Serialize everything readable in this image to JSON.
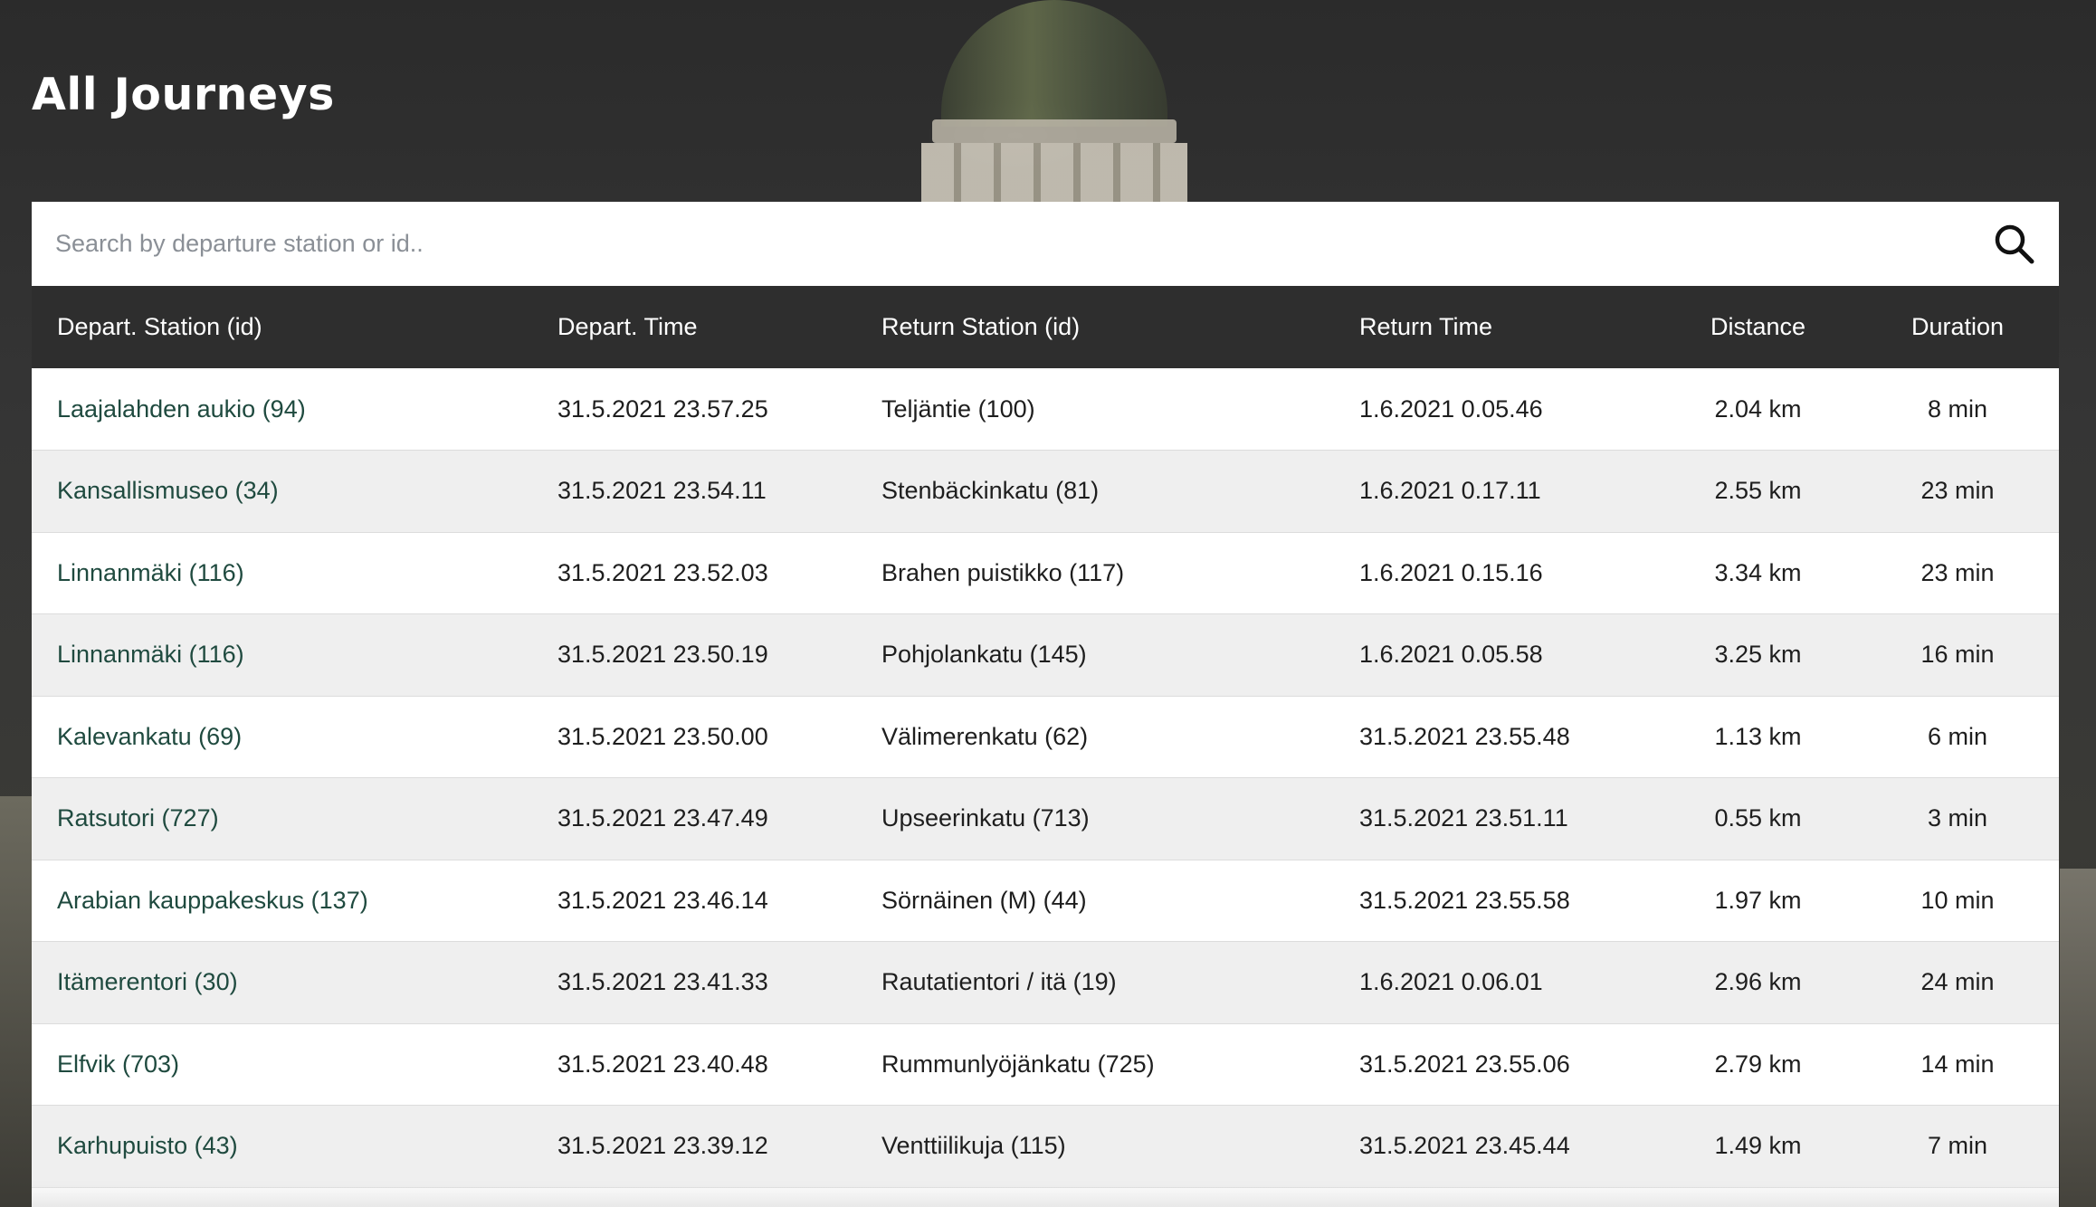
{
  "page": {
    "title": "All Journeys"
  },
  "search": {
    "placeholder": "Search by departure station or id..",
    "icon": "search-icon"
  },
  "table": {
    "headers": {
      "departure_station": "Depart. Station (id)",
      "departure_time": "Depart. Time",
      "return_station": "Return Station (id)",
      "return_time": "Return Time",
      "distance": "Distance",
      "duration": "Duration"
    },
    "rows": [
      {
        "departure_station": "Laajalahden aukio (94)",
        "departure_time": "31.5.2021 23.57.25",
        "return_station": "Teljäntie (100)",
        "return_time": "1.6.2021 0.05.46",
        "distance": "2.04 km",
        "duration": "8 min"
      },
      {
        "departure_station": "Kansallismuseo (34)",
        "departure_time": "31.5.2021 23.54.11",
        "return_station": "Stenbäckinkatu (81)",
        "return_time": "1.6.2021 0.17.11",
        "distance": "2.55 km",
        "duration": "23 min"
      },
      {
        "departure_station": "Linnanmäki (116)",
        "departure_time": "31.5.2021 23.52.03",
        "return_station": "Brahen puistikko (117)",
        "return_time": "1.6.2021 0.15.16",
        "distance": "3.34 km",
        "duration": "23 min"
      },
      {
        "departure_station": "Linnanmäki (116)",
        "departure_time": "31.5.2021 23.50.19",
        "return_station": "Pohjolankatu (145)",
        "return_time": "1.6.2021 0.05.58",
        "distance": "3.25 km",
        "duration": "16 min"
      },
      {
        "departure_station": "Kalevankatu (69)",
        "departure_time": "31.5.2021 23.50.00",
        "return_station": "Välimerenkatu (62)",
        "return_time": "31.5.2021 23.55.48",
        "distance": "1.13 km",
        "duration": "6 min"
      },
      {
        "departure_station": "Ratsutori (727)",
        "departure_time": "31.5.2021 23.47.49",
        "return_station": "Upseerinkatu (713)",
        "return_time": "31.5.2021 23.51.11",
        "distance": "0.55 km",
        "duration": "3 min"
      },
      {
        "departure_station": "Arabian kauppakeskus (137)",
        "departure_time": "31.5.2021 23.46.14",
        "return_station": "Sörnäinen (M) (44)",
        "return_time": "31.5.2021 23.55.58",
        "distance": "1.97 km",
        "duration": "10 min"
      },
      {
        "departure_station": "Itämerentori (30)",
        "departure_time": "31.5.2021 23.41.33",
        "return_station": "Rautatientori / itä (19)",
        "return_time": "1.6.2021 0.06.01",
        "distance": "2.96 km",
        "duration": "24 min"
      },
      {
        "departure_station": "Elfvik (703)",
        "departure_time": "31.5.2021 23.40.48",
        "return_station": "Rummunlyöjänkatu (725)",
        "return_time": "31.5.2021 23.55.06",
        "distance": "2.79 km",
        "duration": "14 min"
      },
      {
        "departure_station": "Karhupuisto (43)",
        "departure_time": "31.5.2021 23.39.12",
        "return_station": "Venttiilikuja (115)",
        "return_time": "31.5.2021 23.45.44",
        "distance": "1.49 km",
        "duration": "7 min"
      }
    ]
  },
  "colors": {
    "header_bg": "#2e2e2e",
    "station_link": "#1f4a3f",
    "row_alt": "#efefef"
  }
}
